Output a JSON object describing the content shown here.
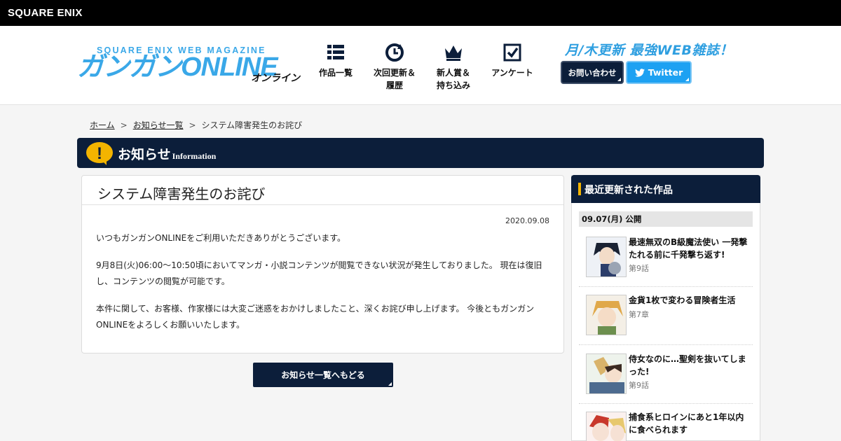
{
  "topbar": {
    "brand": "SQUARE ENIX"
  },
  "logo": {
    "sub": "SQUARE ENIX WEB MAGAZINE",
    "main": "ガンガンONLINE",
    "kana": "オンライン"
  },
  "nav": [
    {
      "label": "作品一覧",
      "icon": "list-grid-icon"
    },
    {
      "label": "次回更新＆\n履歴",
      "icon": "clock-refresh-icon"
    },
    {
      "label": "新人賞＆\n持ち込み",
      "icon": "crown-icon"
    },
    {
      "label": "アンケート",
      "icon": "checkbox-icon"
    }
  ],
  "header": {
    "tagline": "月/木更新 最強WEB雑誌！",
    "contact_label": "お問い合わせ",
    "twitter_label": "Twitter"
  },
  "breadcrumb": {
    "home": "ホーム",
    "sep": ">",
    "list": "お知らせ一覧",
    "current": "システム障害発生のお詫び"
  },
  "section": {
    "title": "お知らせ",
    "title_en": "Information",
    "badge": "!"
  },
  "article": {
    "title": "システム障害発生のお詫び",
    "date": "2020.09.08",
    "paragraphs": [
      "いつもガンガンONLINEをご利用いただきありがとうございます。",
      "9月8日(火)06:00～10:50頃においてマンガ・小説コンテンツが閲覧できない状況が発生しておりました。 現在は復旧し、コンテンツの閲覧が可能です。",
      "本件に関して、お客様、作家様には大変ご迷惑をおかけしましたこと、深くお詫び申し上げます。 今後ともガンガンONLINEをよろしくお願いいたします。"
    ],
    "back_label": "お知らせ一覧へもどる"
  },
  "sidebar": {
    "title": "最近更新された作品",
    "date_label": "09.07(月) 公開",
    "works": [
      {
        "title": "最速無双のB級魔法使い 一発撃たれる前に千発撃ち返す!",
        "episode": "第9話"
      },
      {
        "title": "金貨1枚で変わる冒険者生活",
        "episode": "第7章"
      },
      {
        "title": "侍女なのに…聖剣を抜いてしまった!",
        "episode": "第9話"
      },
      {
        "title": "捕食系ヒロインにあと1年以内に食べられます",
        "episode": ""
      }
    ]
  },
  "colors": {
    "navy": "#0c1e3a",
    "accent_blue": "#3aa8e8",
    "twitter": "#1da1f2",
    "marker": "#f3b400"
  }
}
